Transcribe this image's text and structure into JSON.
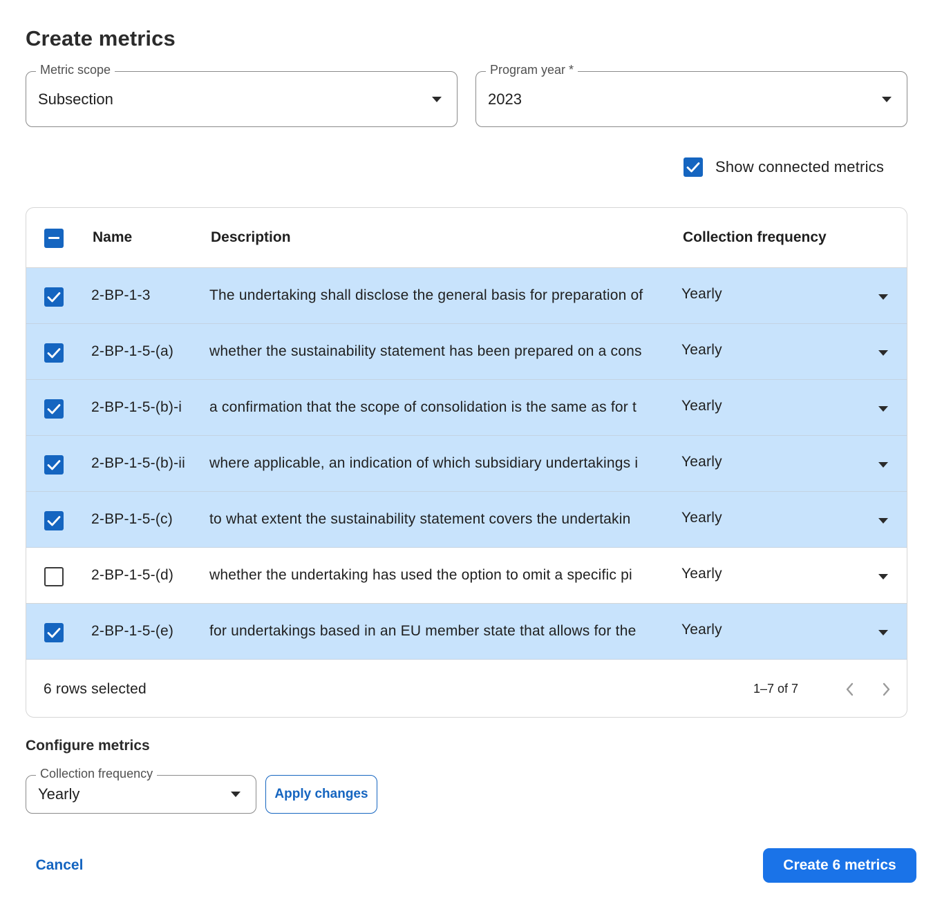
{
  "dialog": {
    "title": "Create metrics"
  },
  "metric_scope": {
    "label": "Metric scope",
    "value": "Subsection"
  },
  "program_year": {
    "label": "Program year *",
    "value": "2023"
  },
  "show_connected": {
    "label": "Show connected metrics",
    "checked": true
  },
  "table": {
    "columns": [
      "Name",
      "Description",
      "Collection frequency"
    ],
    "rows": [
      {
        "name": "2-BP-1-3",
        "description": "The undertaking shall disclose the general basis for preparation of",
        "frequency": "Yearly",
        "selected": true
      },
      {
        "name": "2-BP-1-5-(a)",
        "description": "whether the sustainability statement has been prepared on a cons",
        "frequency": "Yearly",
        "selected": true
      },
      {
        "name": "2-BP-1-5-(b)-i",
        "description": "a confirmation that the scope of consolidation is the same as for t",
        "frequency": "Yearly",
        "selected": true
      },
      {
        "name": "2-BP-1-5-(b)-ii",
        "description": "where applicable, an indication of which subsidiary undertakings i",
        "frequency": "Yearly",
        "selected": true
      },
      {
        "name": "2-BP-1-5-(c)",
        "description": "to what extent the sustainability statement covers the undertakin",
        "frequency": "Yearly",
        "selected": true
      },
      {
        "name": "2-BP-1-5-(d)",
        "description": "whether the undertaking has used the option to omit a specific pi",
        "frequency": "Yearly",
        "selected": false
      },
      {
        "name": "2-BP-1-5-(e)",
        "description": "for undertakings based in an EU member state that allows for the",
        "frequency": "Yearly",
        "selected": true
      }
    ],
    "footer": {
      "selected_text": "6 rows selected",
      "range_text": "1–7 of 7"
    }
  },
  "configure": {
    "title": "Configure metrics",
    "frequency_label": "Collection frequency",
    "frequency_value": "Yearly",
    "apply_label": "Apply changes"
  },
  "actions": {
    "cancel_label": "Cancel",
    "create_label": "Create 6 metrics"
  },
  "colors": {
    "accent": "#1565c0",
    "primary_button": "#1a73e8",
    "selected_row": "#c8e3fc"
  }
}
